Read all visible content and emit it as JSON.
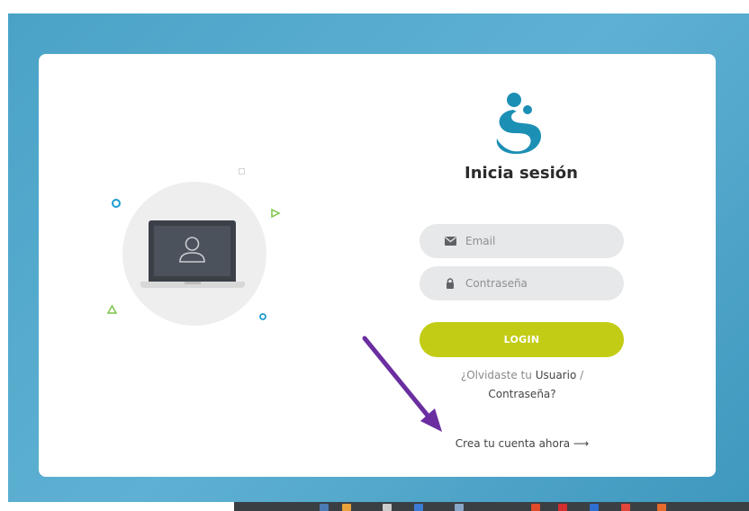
{
  "login": {
    "title": "Inicia sesión",
    "email_placeholder": "Email",
    "password_placeholder": "Contraseña",
    "login_label": "LOGIN",
    "forgot_prefix": "¿Olvidaste tu ",
    "forgot_user": "Usuario",
    "forgot_sep": " /",
    "forgot_password": "Contraseña?",
    "create_account": "Crea tu cuenta ahora",
    "create_arrow": "⟶"
  },
  "colors": {
    "background": "#4aa3c7",
    "login_button": "#c2cc14",
    "logo": "#1c8fb4",
    "annotation_arrow": "#6a2ea0"
  },
  "icons": {
    "email": "envelope-icon",
    "password": "lock-icon",
    "illustration": "user-icon"
  }
}
